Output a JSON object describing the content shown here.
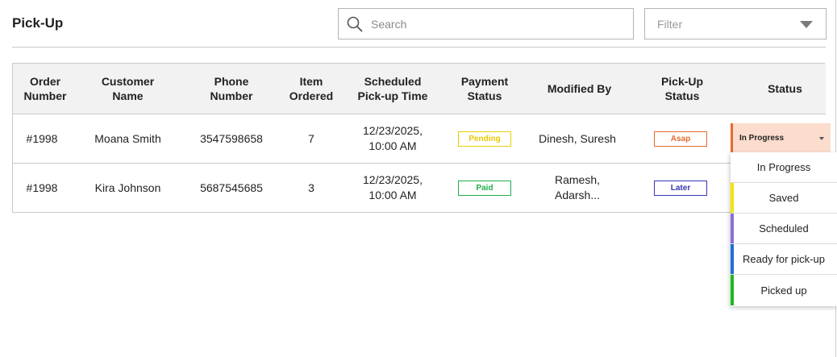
{
  "header": {
    "title": "Pick-Up",
    "search_placeholder": "Search",
    "filter_placeholder": "Filter"
  },
  "table": {
    "columns": [
      "Order Number",
      "Customer Name",
      "Phone Number",
      "Item Ordered",
      "Scheduled Pick-up Time",
      "Payment Status",
      "Modified By",
      "Pick-Up Status",
      "Status"
    ],
    "rows": [
      {
        "order": "#1998",
        "customer": "Moana Smith",
        "phone": "3547598658",
        "items": "7",
        "time": "12/23/2025,\n10:00 AM",
        "payment": "Pending",
        "modified": "Dinesh, Suresh",
        "pickup": "Asap",
        "status": "In Progress"
      },
      {
        "order": "#1998",
        "customer": "Kira Johnson",
        "phone": "5687545685",
        "items": "3",
        "time": "12/23/2025,\n10:00 AM",
        "payment": "Paid",
        "modified": "Ramesh,\nAdarsh...",
        "pickup": "Later",
        "status": ""
      }
    ]
  },
  "status_dropdown": {
    "options": [
      {
        "label": "In Progress",
        "color": "#ffffff"
      },
      {
        "label": "Saved",
        "color": "#f2e600"
      },
      {
        "label": "Scheduled",
        "color": "#8a6fd6"
      },
      {
        "label": "Ready for pick-up",
        "color": "#1f6fd6"
      },
      {
        "label": "Picked up",
        "color": "#1fb81f"
      }
    ]
  },
  "colors": {
    "pending": "#e8d000",
    "paid": "#1fae4a",
    "asap": "#e36b2f",
    "later": "#3a35b5",
    "in_progress_fill": "#fbdccd",
    "in_progress_bar": "#e36b2f"
  }
}
